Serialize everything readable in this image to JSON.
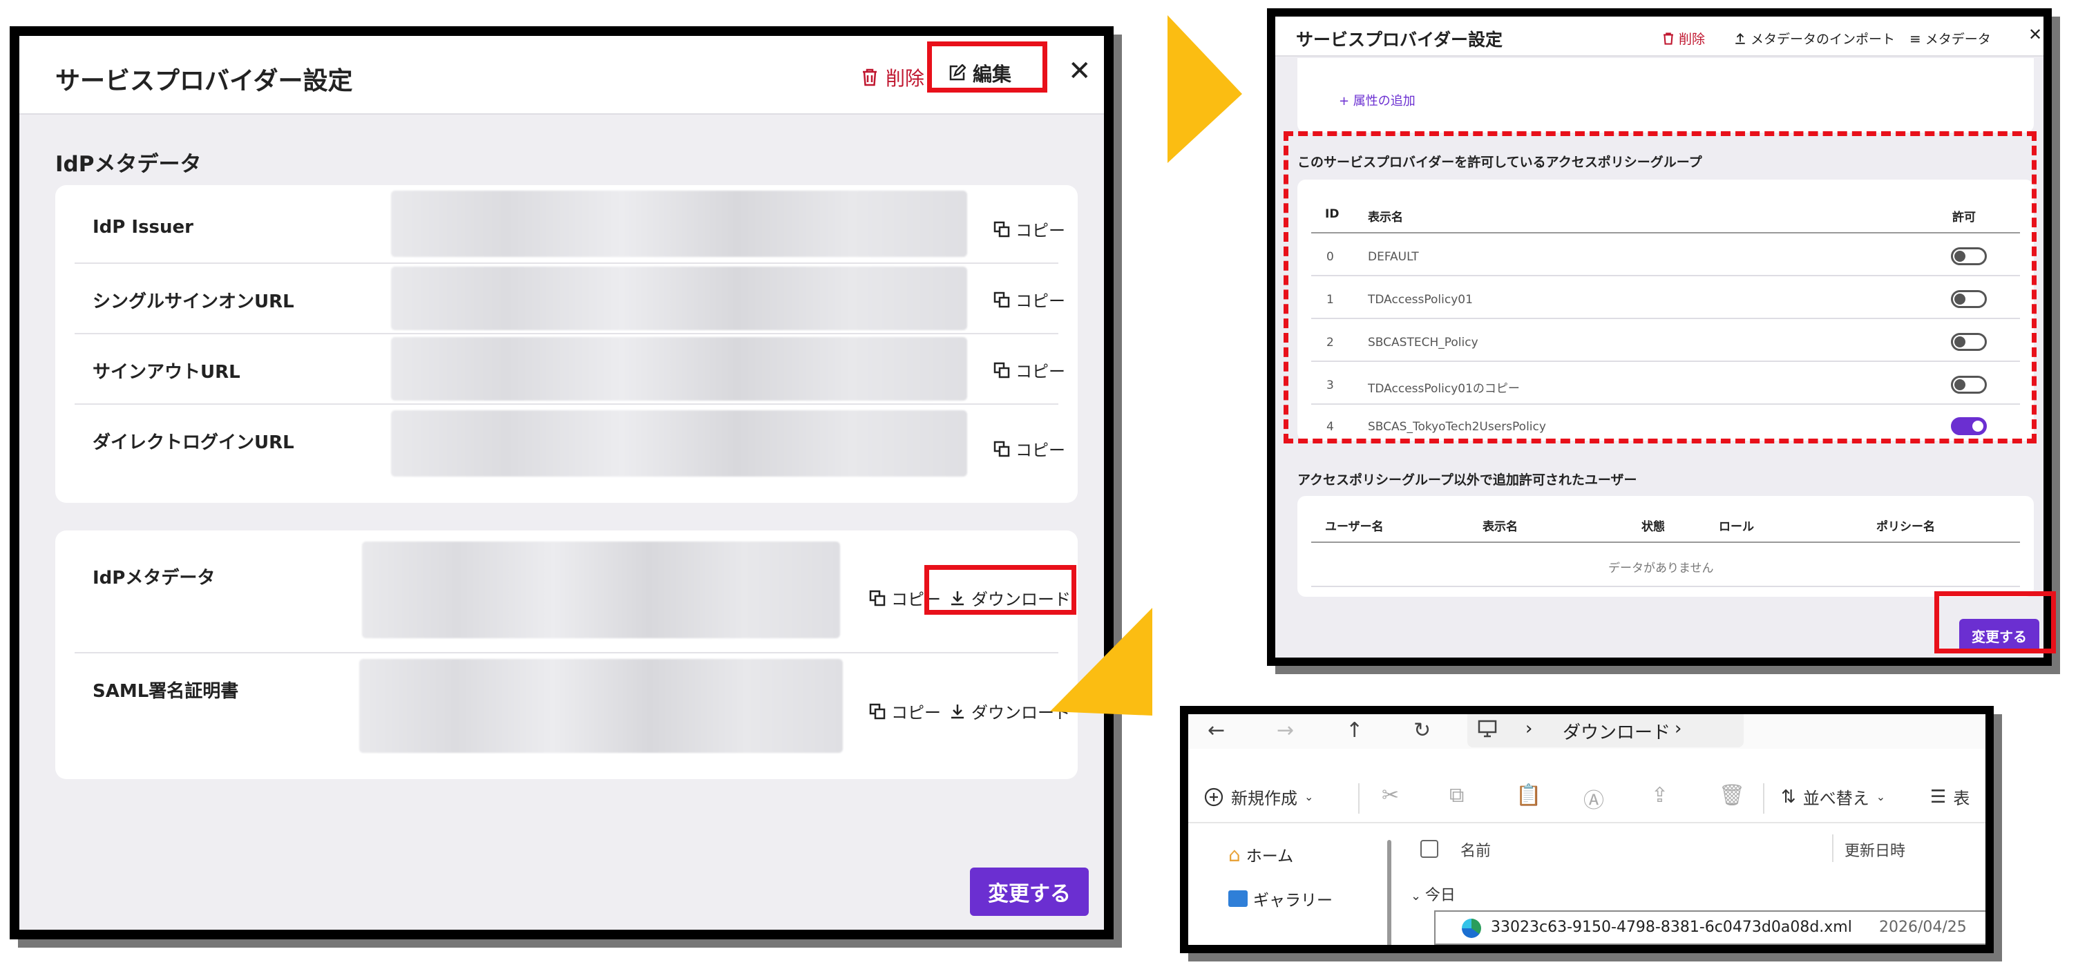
{
  "panel1": {
    "title": "サービスプロバイダー設定",
    "delete_label": "削除",
    "edit_label": "編集",
    "close_glyph": "✕",
    "section_title": "IdPメタデータ",
    "fields": [
      {
        "label": "IdP Issuer",
        "copy": "コピー"
      },
      {
        "label": "シングルサインオンURL",
        "copy": "コピー"
      },
      {
        "label": "サインアウトURL",
        "copy": "コピー"
      },
      {
        "label": "ダイレクトログインURL",
        "copy": "コピー"
      }
    ],
    "downloads": [
      {
        "label": "IdPメタデータ",
        "copy": "コピー",
        "download": "ダウンロード"
      },
      {
        "label": "SAML署名証明書",
        "copy": "コピー",
        "download": "ダウンロード"
      }
    ],
    "submit_label": "変更する"
  },
  "panel2": {
    "title": "サービスプロバイダー設定",
    "delete_label": "削除",
    "import_label": "メタデータのインポート",
    "metadata_label": "メタデータ",
    "close_glyph": "✕",
    "add_attribute": "+ 属性の追加",
    "policy_section_title": "このサービスプロバイダーを許可しているアクセスポリシーグループ",
    "policy_headers": {
      "id": "ID",
      "name": "表示名",
      "allow": "許可"
    },
    "policies": [
      {
        "id": "0",
        "name": "DEFAULT",
        "allowed": false
      },
      {
        "id": "1",
        "name": "TDAccessPolicy01",
        "allowed": false
      },
      {
        "id": "2",
        "name": "SBCASTECH_Policy",
        "allowed": false
      },
      {
        "id": "3",
        "name": "TDAccessPolicy01のコピー",
        "allowed": false
      },
      {
        "id": "4",
        "name": "SBCAS_TokyoTech2UsersPolicy",
        "allowed": true
      }
    ],
    "users_section_title": "アクセスポリシーグループ以外で追加許可されたユーザー",
    "users_headers": {
      "user": "ユーザー名",
      "name": "表示名",
      "state": "状態",
      "role": "ロール",
      "policy": "ポリシー名"
    },
    "no_data": "データがありません",
    "submit_label": "変更する"
  },
  "panel3": {
    "breadcrumb_sep": "›",
    "breadcrumb_folder": "ダウンロード",
    "new_label": "新規作成",
    "sort_label": "並べ替え",
    "view_label": "表",
    "sidebar": [
      {
        "label": "ホーム",
        "icon": "home-icon"
      },
      {
        "label": "ギャラリー",
        "icon": "gallery-icon"
      }
    ],
    "col_name": "名前",
    "col_modified": "更新日時",
    "group_label": "今日",
    "file": {
      "name": "33023c63-9150-4798-8381-6c0473d0a08d.xml",
      "modified": "2026/04/25"
    }
  },
  "colors": {
    "accent": "#6b2fd1",
    "danger": "#c0162f",
    "highlight": "#e8101a",
    "arrow": "#fbbd12"
  }
}
